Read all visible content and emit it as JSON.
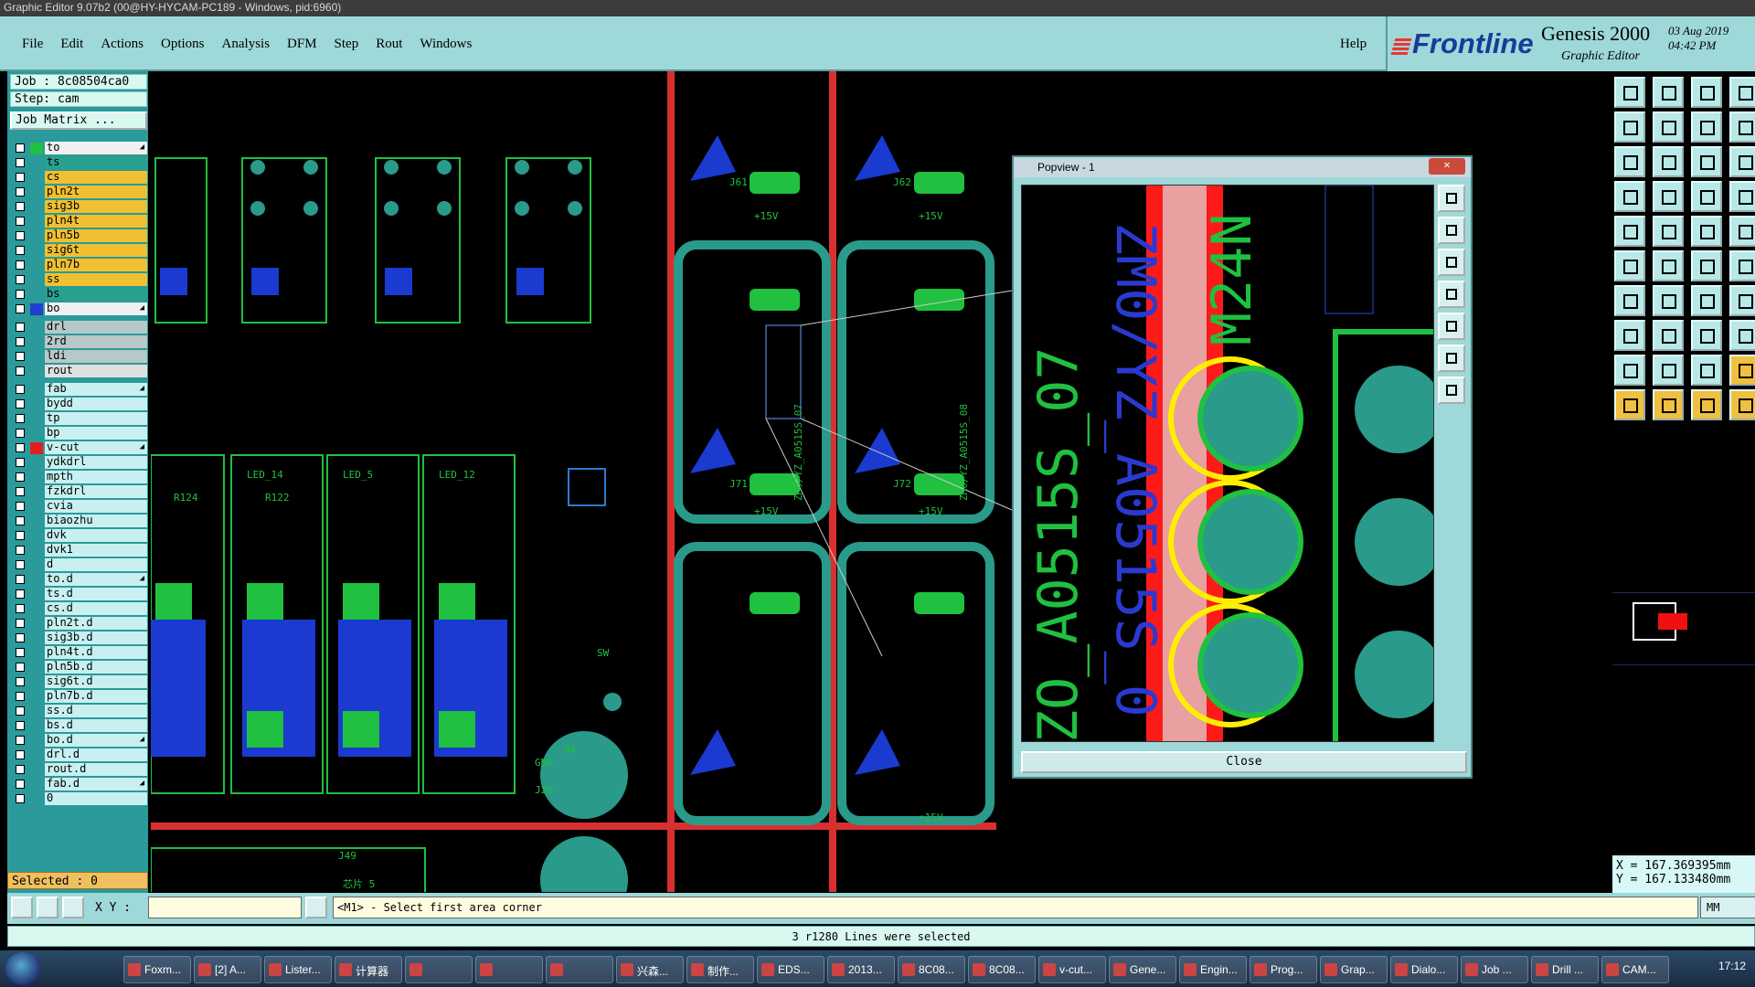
{
  "window": {
    "title": "Graphic Editor 9.07b2 (00@HY-HYCAM-PC189 - Windows, pid:6960)"
  },
  "menu": {
    "items": [
      "File",
      "Edit",
      "Actions",
      "Options",
      "Analysis",
      "DFM",
      "Step",
      "Rout",
      "Windows"
    ],
    "help": "Help"
  },
  "brand": {
    "logo": "Frontline",
    "product": "Genesis 2000",
    "subtitle": "Graphic Editor",
    "date": "03 Aug 2019",
    "time": "04:42 PM"
  },
  "job": {
    "job_label": "Job : 8c08504ca0",
    "step_label": "Step: cam",
    "matrix_button": "Job Matrix ..."
  },
  "layers": [
    {
      "name": "to",
      "color": "#f0f0f0",
      "swatch": "#20c040",
      "arrow": true
    },
    {
      "name": "ts",
      "color": "#2aa090",
      "swatch": ""
    },
    {
      "name": "cs",
      "color": "#f0c030",
      "swatch": ""
    },
    {
      "name": "pln2t",
      "color": "#f0c030",
      "swatch": ""
    },
    {
      "name": "sig3b",
      "color": "#f0c030",
      "swatch": ""
    },
    {
      "name": "pln4t",
      "color": "#f0c030",
      "swatch": ""
    },
    {
      "name": "pln5b",
      "color": "#f0c030",
      "swatch": ""
    },
    {
      "name": "sig6t",
      "color": "#f0c030",
      "swatch": ""
    },
    {
      "name": "pln7b",
      "color": "#f0c030",
      "swatch": ""
    },
    {
      "name": "ss",
      "color": "#f0c030",
      "swatch": ""
    },
    {
      "name": "bs",
      "color": "#2aa090",
      "swatch": ""
    },
    {
      "name": "bo",
      "color": "#f0f0f0",
      "swatch": "#2040d0",
      "arrow": true
    },
    {
      "sep": true
    },
    {
      "name": "drl",
      "color": "#b8c8c8",
      "swatch": ""
    },
    {
      "name": "2rd",
      "color": "#b8c8c8",
      "swatch": ""
    },
    {
      "name": "ldi",
      "color": "#b8c8c8",
      "swatch": ""
    },
    {
      "name": "rout",
      "color": "#e0e0e0",
      "swatch": ""
    },
    {
      "sep": true
    },
    {
      "name": "fab",
      "color": "#c8f0f0",
      "swatch": "",
      "arrow": true
    },
    {
      "name": "bydd",
      "color": "#c8f0f0",
      "swatch": ""
    },
    {
      "name": "tp",
      "color": "#c8f0f0",
      "swatch": ""
    },
    {
      "name": "bp",
      "color": "#c8f0f0",
      "swatch": ""
    },
    {
      "name": "v-cut",
      "color": "#c8f0f0",
      "swatch": "#e02020",
      "arrow": true
    },
    {
      "name": "ydkdrl",
      "color": "#c8f0f0",
      "swatch": ""
    },
    {
      "name": "mpth",
      "color": "#c8f0f0",
      "swatch": ""
    },
    {
      "name": "fzkdrl",
      "color": "#c8f0f0",
      "swatch": ""
    },
    {
      "name": "cvia",
      "color": "#c8f0f0",
      "swatch": ""
    },
    {
      "name": "biaozhu",
      "color": "#c8f0f0",
      "swatch": ""
    },
    {
      "name": "dvk",
      "color": "#c8f0f0",
      "swatch": ""
    },
    {
      "name": "dvk1",
      "color": "#c8f0f0",
      "swatch": ""
    },
    {
      "name": "d",
      "color": "#c8f0f0",
      "swatch": ""
    },
    {
      "name": "to.d",
      "color": "#c8f0f0",
      "swatch": "",
      "arrow": true
    },
    {
      "name": "ts.d",
      "color": "#c8f0f0",
      "swatch": ""
    },
    {
      "name": "cs.d",
      "color": "#c8f0f0",
      "swatch": ""
    },
    {
      "name": "pln2t.d",
      "color": "#c8f0f0",
      "swatch": ""
    },
    {
      "name": "sig3b.d",
      "color": "#c8f0f0",
      "swatch": ""
    },
    {
      "name": "pln4t.d",
      "color": "#c8f0f0",
      "swatch": ""
    },
    {
      "name": "pln5b.d",
      "color": "#c8f0f0",
      "swatch": ""
    },
    {
      "name": "sig6t.d",
      "color": "#c8f0f0",
      "swatch": ""
    },
    {
      "name": "pln7b.d",
      "color": "#c8f0f0",
      "swatch": ""
    },
    {
      "name": "ss.d",
      "color": "#c8f0f0",
      "swatch": ""
    },
    {
      "name": "bs.d",
      "color": "#c8f0f0",
      "swatch": ""
    },
    {
      "name": "bo.d",
      "color": "#c8f0f0",
      "swatch": "",
      "arrow": true
    },
    {
      "name": "drl.d",
      "color": "#c8f0f0",
      "swatch": ""
    },
    {
      "name": "rout.d",
      "color": "#c8f0f0",
      "swatch": ""
    },
    {
      "name": "fab.d",
      "color": "#c8f0f0",
      "swatch": "",
      "arrow": true
    },
    {
      "name": "0",
      "color": "#c8f0f0",
      "swatch": ""
    }
  ],
  "selected": "Selected : 0",
  "command": {
    "xy_label": "X Y :",
    "xy_value": "",
    "prompt": "<M1> - Select first area corner",
    "units": "MM"
  },
  "status": "3 r1280 Lines were selected",
  "coords": {
    "x": "X = 167.369395mm",
    "y": "Y = 167.133480mm"
  },
  "popview": {
    "title": "Popview - 1",
    "close": "Close",
    "text1": "ZO_A0515S_07",
    "text2": "ZM0/YZ_A0515S_0",
    "text3": "M24N"
  },
  "canvas_labels": {
    "r1": "R124",
    "r2": "R122",
    "led1": "LED_14",
    "led2": "LED_5",
    "led3": "LED_12",
    "j61": "J61",
    "j62": "J62",
    "j71": "J71",
    "j72": "J72",
    "v15": "+15V",
    "ref1": "ZM0/YZ_A0515S_07",
    "ref2": "ZM0/YZ_A0515S_08",
    "chip": "芯片 5",
    "j49": "J49",
    "m4": "M4",
    "gnd": "GND",
    "j28": "J28",
    "sw": "SW"
  },
  "taskbar": {
    "items": [
      "Foxm...",
      "[2] A...",
      "Lister...",
      "计算器",
      "",
      "",
      "",
      "兴森...",
      "制作...",
      "EDS...",
      "2013...",
      "8C08...",
      "8C08...",
      "v-cut...",
      "Gene...",
      "Engin...",
      "Prog...",
      "Grap...",
      "Dialo...",
      "Job ...",
      "Drill ...",
      "CAM..."
    ],
    "clock": "17:12"
  }
}
